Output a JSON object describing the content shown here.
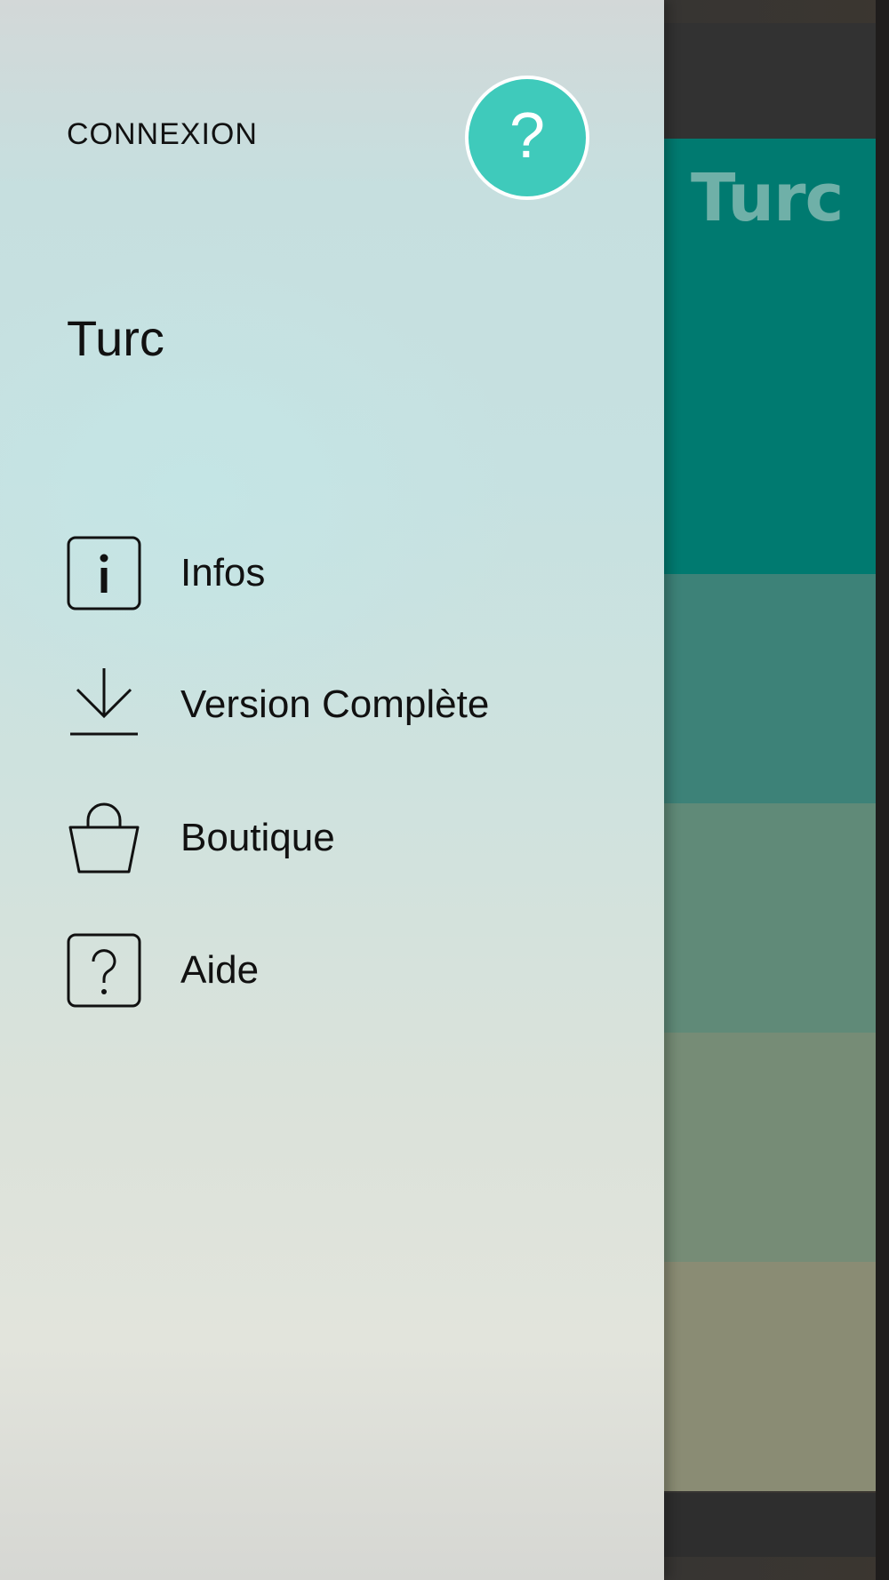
{
  "drawer": {
    "login_label": "CONNEXION",
    "help_button_glyph": "?",
    "language_title": "Turc",
    "menu": [
      {
        "label": "Infos",
        "icon": "info-icon"
      },
      {
        "label": "Version Complète",
        "icon": "download-icon"
      },
      {
        "label": "Boutique",
        "icon": "shopping-bag-icon"
      },
      {
        "label": "Aide",
        "icon": "help-icon"
      }
    ]
  },
  "background": {
    "hero_title": "Turc"
  },
  "colors": {
    "accent": "#3fcabb",
    "hero": "#007a70"
  }
}
